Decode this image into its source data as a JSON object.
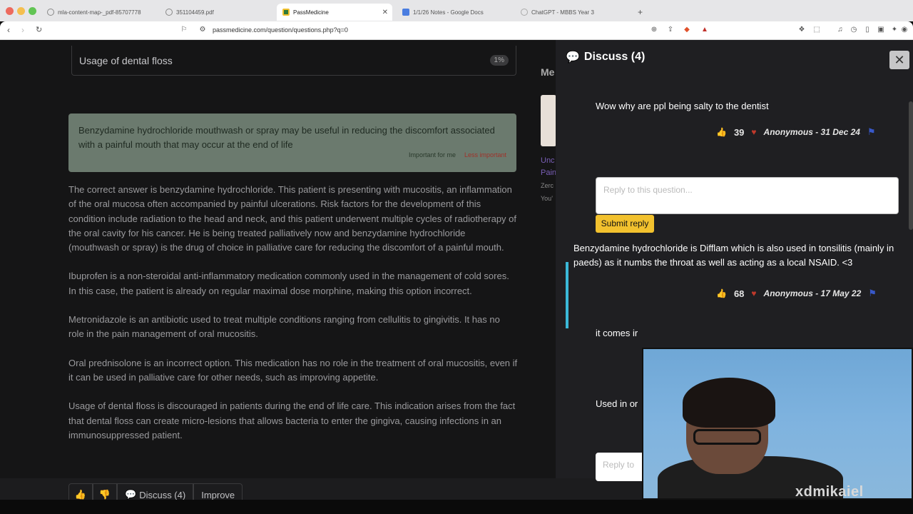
{
  "browser": {
    "tabs": [
      {
        "label": "mla-content-map-_pdf-85707778"
      },
      {
        "label": "351104459.pdf"
      },
      {
        "label": "PassMedicine",
        "active": true
      },
      {
        "label": "1/1/26 Notes - Google Docs"
      },
      {
        "label": "ChatGPT - MBBS Year 3"
      }
    ],
    "url": "passmedicine.com/question/questions.php?q=0"
  },
  "question": {
    "answer_option": {
      "label": "Usage of dental floss",
      "percent": "1%"
    },
    "note": {
      "text": "Benzydamine hydrochloride mouthwash or spray may be useful in reducing the discomfort associated with a painful mouth that may occur at the end of life",
      "important_label": "Important for me",
      "less_important_label": "Less important"
    },
    "explanation": [
      "The correct answer is benzydamine hydrochloride. This patient is presenting with mucositis, an inflammation of the oral mucosa often accompanied by painful ulcerations. Risk factors for the development of this condition include radiation to the head and neck, and this patient underwent multiple cycles of radiotherapy of the oral cavity for his cancer. He is being treated palliatively now and benzydamine hydrochloride (mouthwash or spray) is the drug of choice in palliative care for reducing the discomfort of a painful mouth.",
      "Ibuprofen is a non-steroidal anti-inflammatory medication commonly used in the management of cold sores. In this case, the patient is already on regular maximal dose morphine, making this option incorrect.",
      "Metronidazole is an antibiotic used to treat multiple conditions ranging from cellulitis to gingivitis. It has no role in the pain management of oral mucositis.",
      "Oral prednisolone is an incorrect option. This medication has no role in the treatment of oral mucositis, even if it can be used in palliative care for other needs, such as improving appetite.",
      "Usage of dental floss is discouraged in patients during the end of life care. This indication arises from the fact that dental floss can create micro-lesions that allows bacteria to enter the gingiva, causing infections in an immunosuppressed patient."
    ],
    "actions": {
      "discuss_label": "Discuss (4)",
      "improve_label": "Improve"
    }
  },
  "side_peek": {
    "heading": "Me",
    "line1": "Unc",
    "line2": "Pain",
    "line3": "Zerc",
    "line4": "You'"
  },
  "discuss_panel": {
    "title": "Discuss (4)",
    "comments": [
      {
        "text": "Wow why are ppl being salty to the dentist",
        "votes": "39",
        "author": "Anonymous - 31 Dec 24"
      },
      {
        "text": "Benzydamine hydrochloride is Difflam which is also used in tonsilitis (mainly in paeds) as it numbs the throat as well as acting as a local NSAID. <3",
        "votes": "68",
        "author": "Anonymous - 17 May 22"
      },
      {
        "text": "it comes ir"
      },
      {
        "text": "Used in or"
      }
    ],
    "reply_placeholder": "Reply to this question...",
    "reply_placeholder_2": "Reply to",
    "submit_label": "Submit reply"
  },
  "overlay": {
    "watermark": "xdmikaiel"
  }
}
